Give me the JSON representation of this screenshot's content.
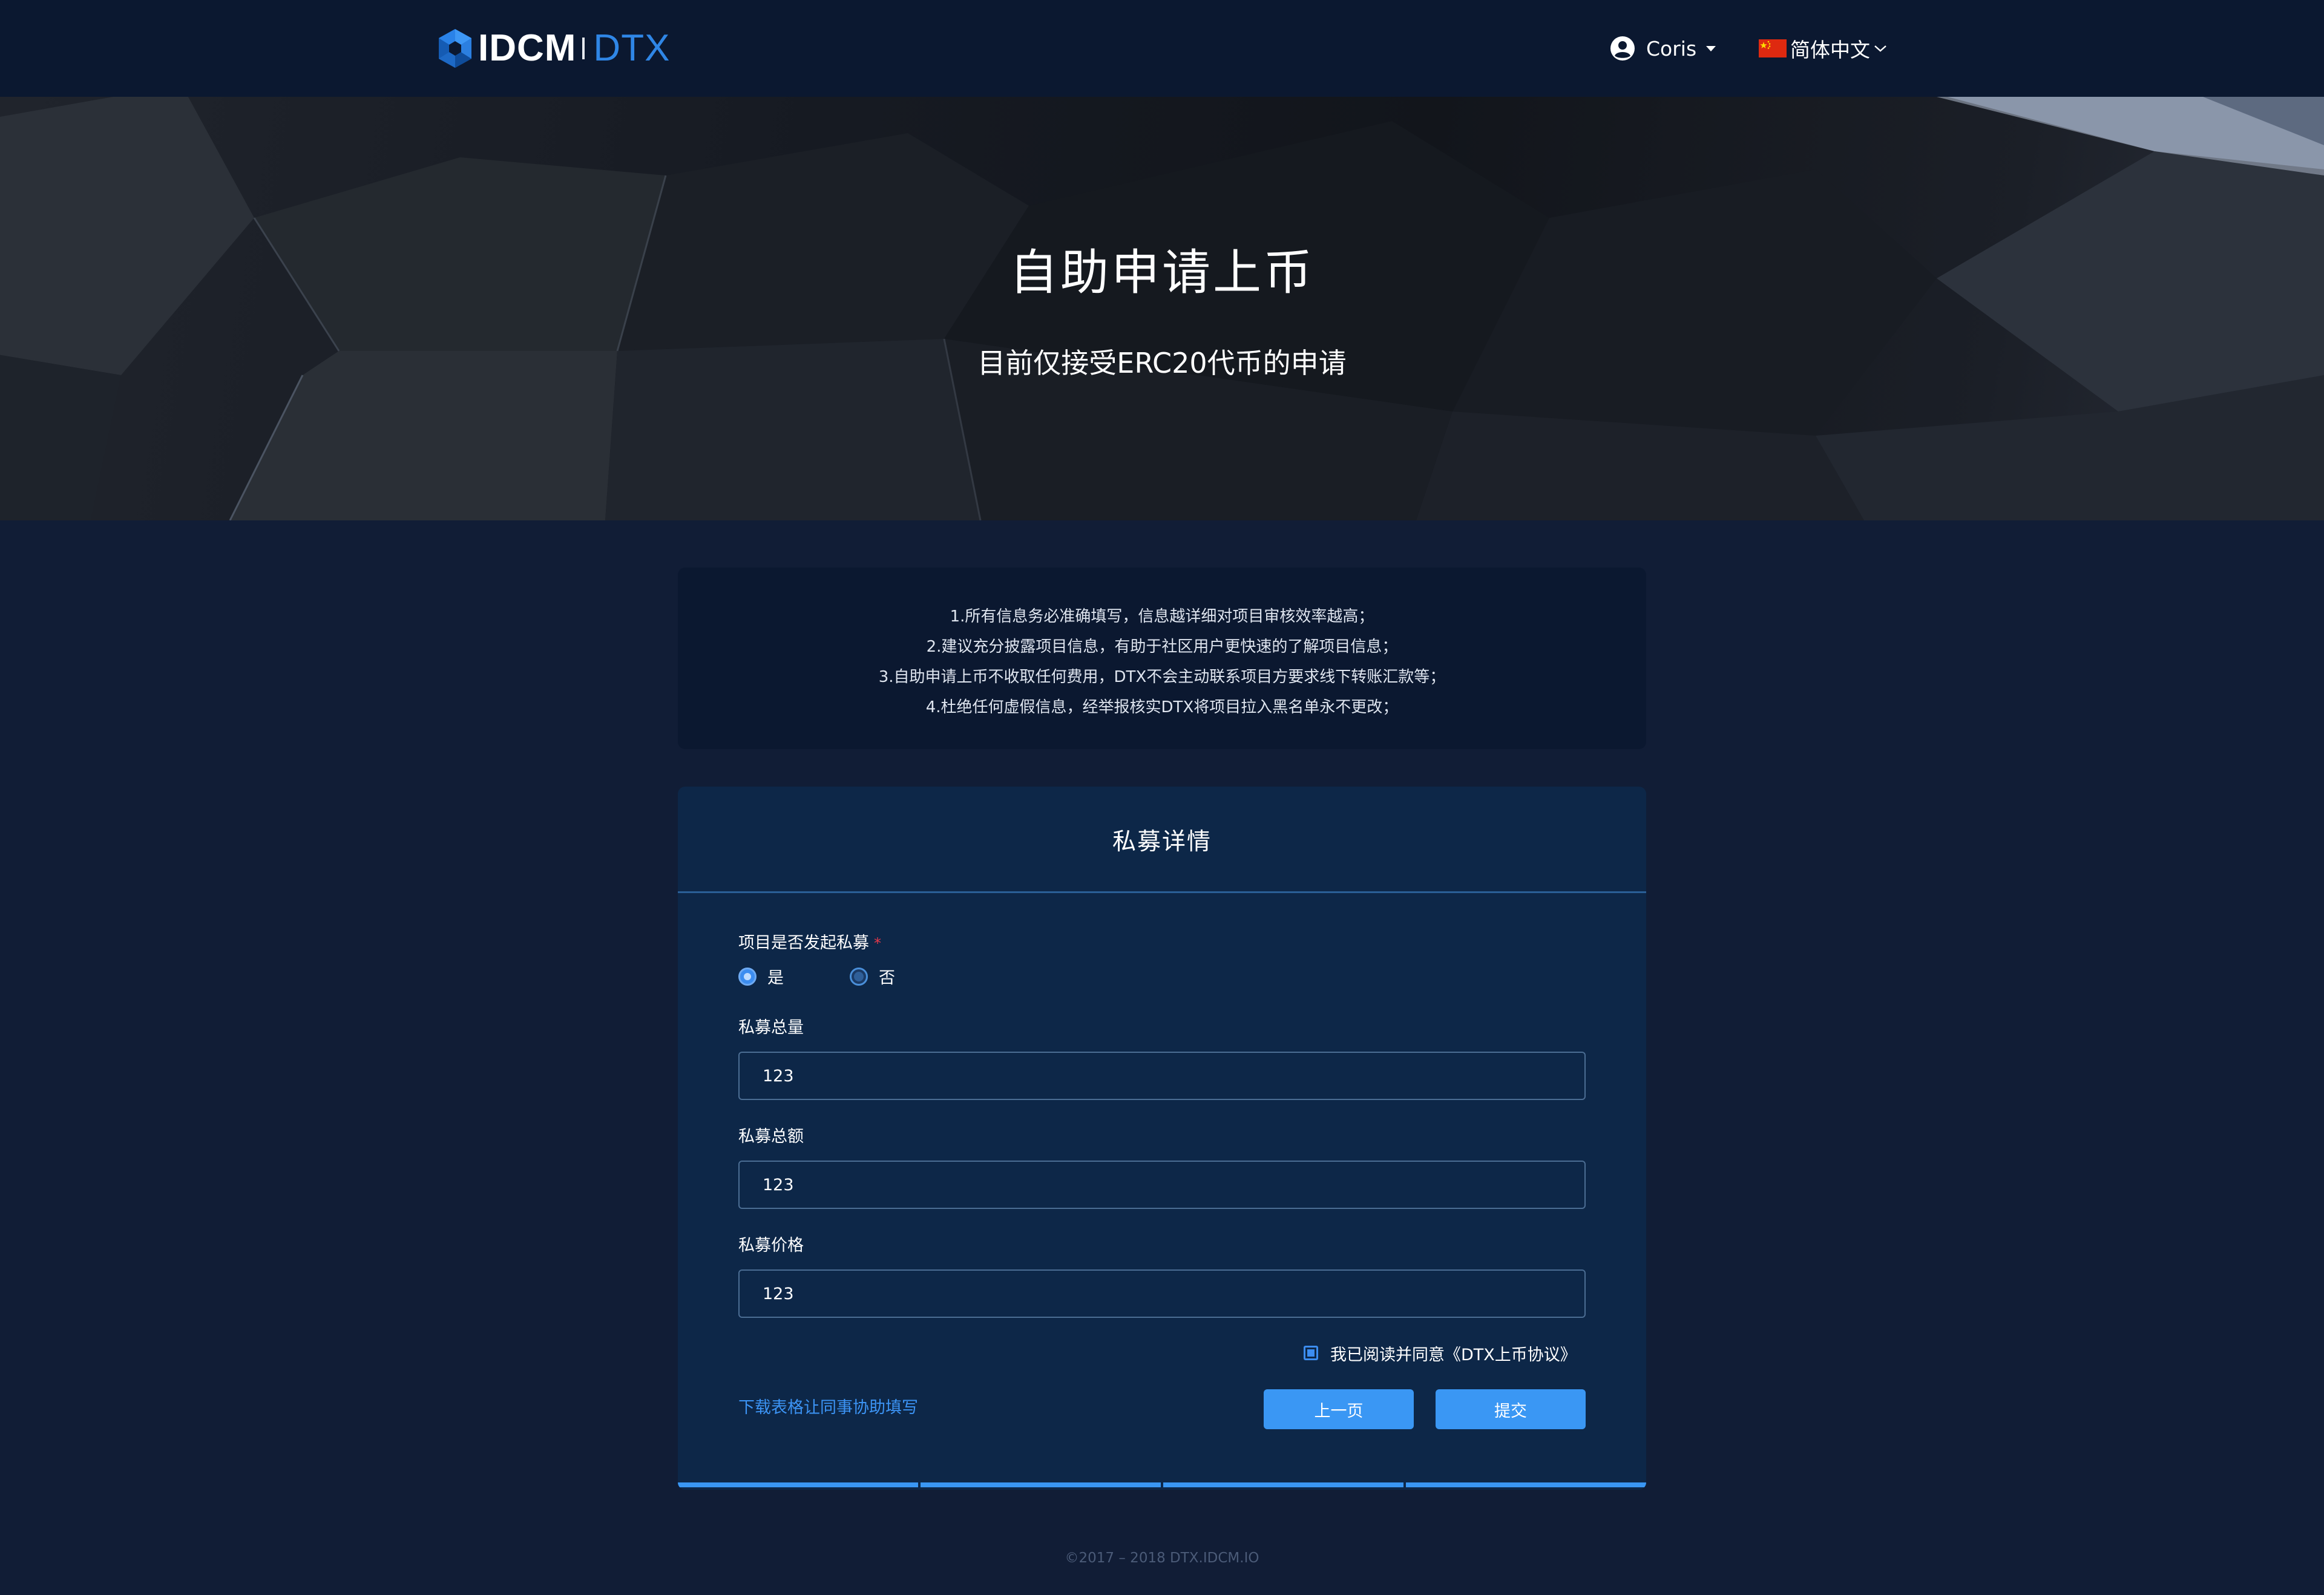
{
  "header": {
    "logo_brand": "IDCM",
    "logo_product": "DTX",
    "user_name": "Coris",
    "language_label": "简体中文"
  },
  "hero": {
    "title": "自助申请上币",
    "subtitle": "目前仅接受ERC20代币的申请"
  },
  "notice": {
    "lines": [
      "1.所有信息务必准确填写，信息越详细对项目审核效率越高；",
      "2.建议充分披露项目信息，有助于社区用户更快速的了解项目信息；",
      "3.自助申请上币不收取任何费用，DTX不会主动联系项目方要求线下转账汇款等；",
      "4.杜绝任何虚假信息，经举报核实DTX将项目拉入黑名单永不更改；"
    ]
  },
  "form": {
    "title": "私募详情",
    "private_sale_question": "项目是否发起私募",
    "required_mark": "*",
    "options": [
      {
        "label": "是",
        "checked": true
      },
      {
        "label": "否",
        "checked": false
      }
    ],
    "fields": [
      {
        "label": "私募总量",
        "value": "123"
      },
      {
        "label": "私募总额",
        "value": "123"
      },
      {
        "label": "私募价格",
        "value": "123"
      }
    ],
    "agreement_label": "我已阅读并同意《DTX上币协议》",
    "agreement_checked": true,
    "download_link": "下载表格让同事协助填写",
    "prev_button": "上一页",
    "submit_button": "提交"
  },
  "footer": {
    "copyright": "©2017 – 2018 DTX.IDCM.IO"
  },
  "colors": {
    "page_bg": "#111d36",
    "header_bg": "#0b1830",
    "card_bg": "#0d2748",
    "accent": "#3a97f4",
    "required": "#e6394a"
  },
  "icons": [
    "idcm-logo-icon",
    "user-avatar-icon",
    "caret-down-icon",
    "china-flag-icon",
    "chevron-down-icon"
  ]
}
